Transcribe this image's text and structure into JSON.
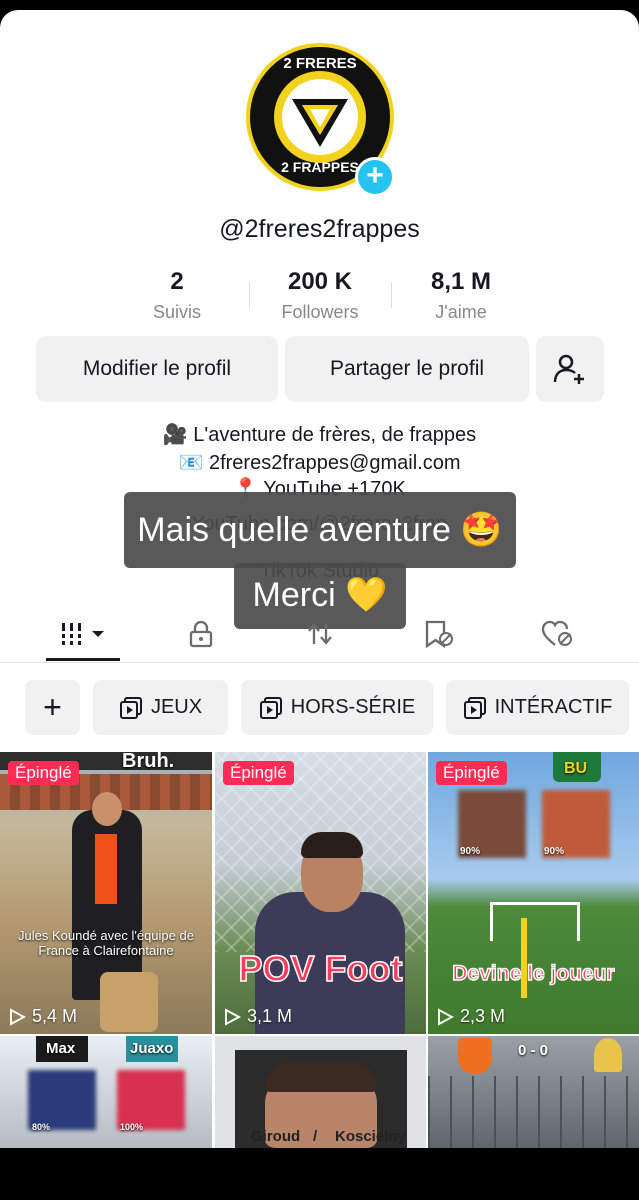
{
  "profile": {
    "logo_text_top": "2 FRERES",
    "logo_text_bottom": "2 FRAPPES",
    "add_badge": "+",
    "username": "@2freres2frappes"
  },
  "stats": [
    {
      "value": "2",
      "label": "Suivis"
    },
    {
      "value": "200 K",
      "label": "Followers"
    },
    {
      "value": "8,1 M",
      "label": "J'aime"
    }
  ],
  "actions": {
    "edit_label": "Modifier le profil",
    "share_label": "Partager le profil",
    "add_friend_icon": "person-plus-icon"
  },
  "bio": {
    "line1": "🎥 L'aventure de frères, de frappes",
    "line2": "📧 2freres2frappes@gmail.com",
    "line3": "📍 YouTube +170K",
    "link": "YouTube.com/@2freres2frap",
    "studio": "TikTok Studio"
  },
  "story_overlay": {
    "line1": "Mais quelle aventure 🤩",
    "line2": "Merci 💛"
  },
  "tabs": [
    {
      "icon": "grid-icon",
      "active": true
    },
    {
      "icon": "lock-icon"
    },
    {
      "icon": "repost-icon"
    },
    {
      "icon": "bookmark-hidden-icon"
    },
    {
      "icon": "liked-hidden-icon"
    }
  ],
  "playlists": {
    "add": "+",
    "items": [
      "JEUX",
      "HORS-SÉRIE",
      "INTÉRACTIF"
    ]
  },
  "videos": [
    {
      "pinned": "Épinglé",
      "views": "5,4 M",
      "overlay_top": "Bruh.",
      "caption": "Jules Koundé avec l'équipe de France à Clairefontaine"
    },
    {
      "pinned": "Épinglé",
      "views": "3,1 M",
      "title": "POV Foot"
    },
    {
      "pinned": "Épinglé",
      "views": "2,3 M",
      "title": "Devine le joueur",
      "tag_right": "BU",
      "pct1": "90%",
      "pct2": "90%"
    },
    {
      "tag_left": "Max",
      "tag_right": "Juaxo",
      "pct1": "80%",
      "pct2": "100%"
    },
    {
      "bottom_left": "Giroud",
      "bottom_right": "Koscielny",
      "sep": "/"
    },
    {
      "score": "0 - 0"
    }
  ],
  "colors": {
    "accent": "#fe2c55",
    "badge": "#25c4ee",
    "logo_yellow": "#f3d21d"
  }
}
